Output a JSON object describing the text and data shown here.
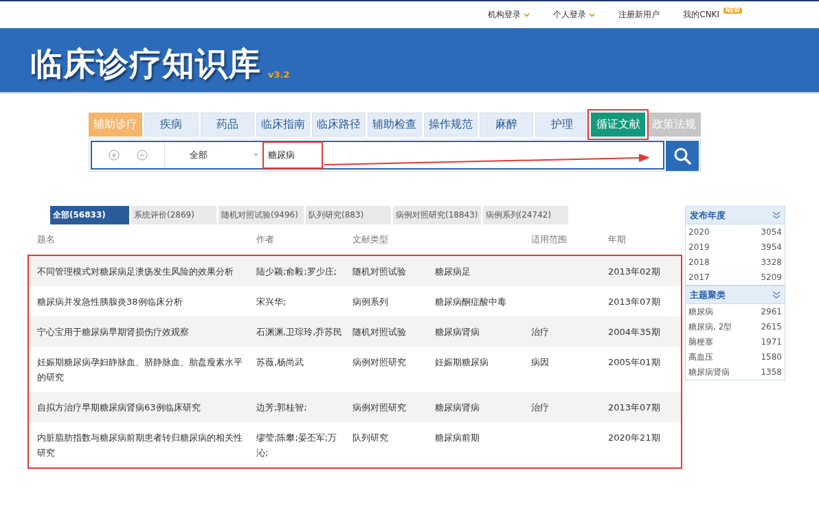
{
  "top_nav": [
    {
      "label": "机构登录",
      "dropdown": true
    },
    {
      "label": "个人登录",
      "dropdown": true
    },
    {
      "label": "注册新用户",
      "dropdown": false
    },
    {
      "label": "我的CNKI",
      "dropdown": false,
      "badge": "NEW"
    }
  ],
  "banner": {
    "title": "临床诊疗知识库",
    "version": "v3.2"
  },
  "category_tabs": [
    {
      "label": "辅助诊疗",
      "kind": "feature",
      "selected": false,
      "annotated": false
    },
    {
      "label": "疾病",
      "kind": "normal",
      "selected": false,
      "annotated": false
    },
    {
      "label": "药品",
      "kind": "normal",
      "selected": false,
      "annotated": false
    },
    {
      "label": "临床指南",
      "kind": "normal",
      "selected": false,
      "annotated": false
    },
    {
      "label": "临床路径",
      "kind": "normal",
      "selected": false,
      "annotated": false
    },
    {
      "label": "辅助检查",
      "kind": "normal",
      "selected": false,
      "annotated": false
    },
    {
      "label": "操作规范",
      "kind": "normal",
      "selected": false,
      "annotated": false
    },
    {
      "label": "麻醉",
      "kind": "normal",
      "selected": false,
      "annotated": false
    },
    {
      "label": "护理",
      "kind": "normal",
      "selected": false,
      "annotated": false
    },
    {
      "label": "循证文献",
      "kind": "normal",
      "selected": true,
      "annotated": true
    },
    {
      "label": "政策法规",
      "kind": "muted",
      "selected": false,
      "annotated": false
    }
  ],
  "search": {
    "scope": "全部",
    "value": "糖尿病",
    "annotated": true,
    "arrow": true
  },
  "result_tabs": [
    {
      "label": "全部(56833)",
      "selected": true
    },
    {
      "label": "系统评价(2869)",
      "selected": false
    },
    {
      "label": "随机对照试验(9496)",
      "selected": false
    },
    {
      "label": "队列研究(883)",
      "selected": false
    },
    {
      "label": "病例对照研究(18843)",
      "selected": false
    },
    {
      "label": "病例系列(24742)",
      "selected": false
    }
  ],
  "table": {
    "annotated": true,
    "header": {
      "title": "题名",
      "authors": "作者",
      "type": "文献类型",
      "scope": "适用范围",
      "issue": "年期"
    },
    "rows": [
      {
        "title": "不同管理模式对糖尿病足溃疡发生风险的效果分析",
        "authors": "陆少颖;俞毅;罗少庄;",
        "type": "随机对照试验",
        "disease": "糖尿病足",
        "issue": "2013年02期"
      },
      {
        "title": "糖尿病并发急性胰腺炎38例临床分析",
        "authors": "宋兴华;",
        "type": "病例系列",
        "disease": "糖尿病酮症酸中毒",
        "issue": "2013年07期"
      },
      {
        "title": "宁心宝用于糖尿病早期肾损伤疗效观察",
        "authors": "石渊渊,卫琮玲,乔苏民",
        "type": "随机对照试验",
        "disease": "糖尿病肾病",
        "scope": "治疗",
        "issue": "2004年35期"
      },
      {
        "title": "妊娠期糖尿病孕妇静脉血、脐静脉血、胎盘瘦素水平的研究",
        "authors": "苏薇,杨尚武",
        "type": "病例对照研究",
        "disease": "妊娠期糖尿病",
        "scope": "病因",
        "issue": "2005年01期"
      },
      {
        "title": "自拟方治疗早期糖尿病肾病63例临床研究",
        "authors": "边芳;郭桂智;",
        "type": "病例对照研究",
        "disease": "糖尿病肾病",
        "scope": "治疗",
        "issue": "2013年07期"
      },
      {
        "title": "内脏脂肪指数与糖尿病前期患者转归糖尿病的相关性研究",
        "authors": "缪莹;陈攀;晏丕军;万沁;",
        "type": "队列研究",
        "disease": "糖尿病前期",
        "issue": "2020年21期"
      }
    ]
  },
  "facets": [
    {
      "title": "发布年度",
      "items": [
        {
          "label": "2020",
          "count": "3054"
        },
        {
          "label": "2019",
          "count": "3954"
        },
        {
          "label": "2018",
          "count": "3328"
        },
        {
          "label": "2017",
          "count": "5209"
        }
      ]
    },
    {
      "title": "主题聚类",
      "items": [
        {
          "label": "糖尿病",
          "count": "2961"
        },
        {
          "label": "糖尿病, 2型",
          "count": "2615"
        },
        {
          "label": "脑梗塞",
          "count": "1971"
        },
        {
          "label": "高血压",
          "count": "1580"
        },
        {
          "label": "糖尿病肾病",
          "count": "1358"
        }
      ]
    }
  ]
}
